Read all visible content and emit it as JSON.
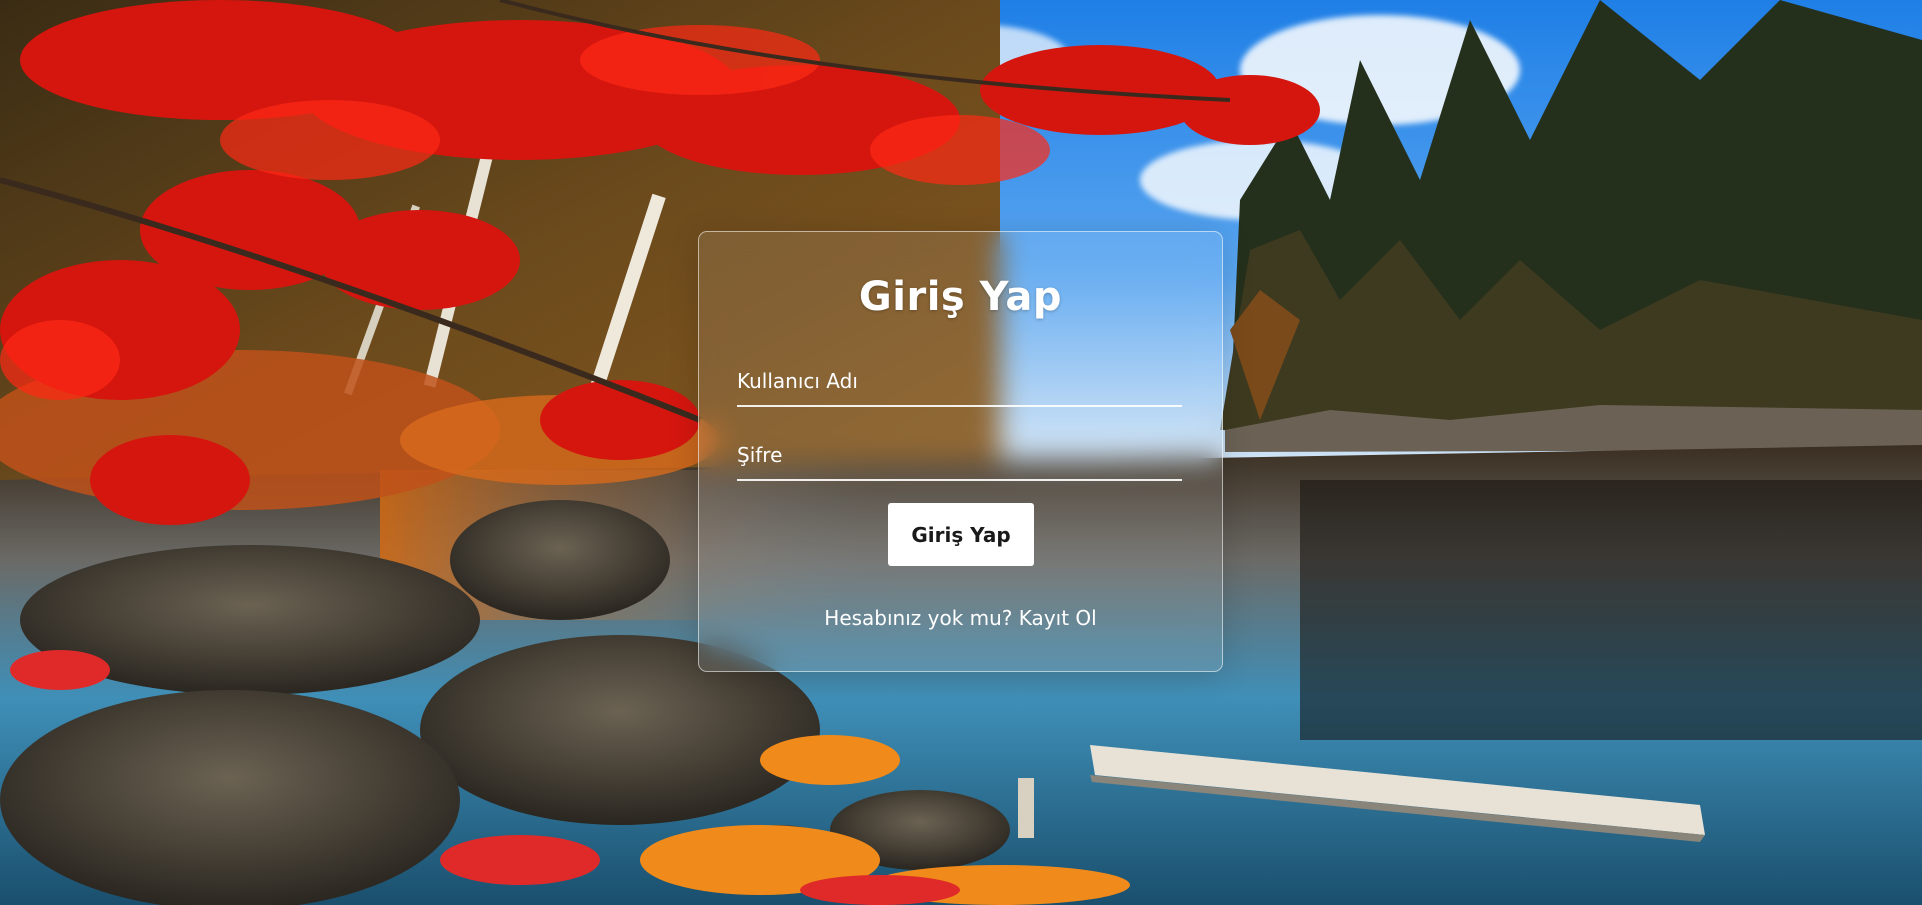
{
  "login": {
    "title": "Giriş Yap",
    "username_placeholder": "Kullanıcı Adı",
    "password_placeholder": "Şifre",
    "submit_label": "Giriş Yap",
    "signup_prompt": "Hesabınız yok mu?",
    "signup_link": "Kayıt Ol"
  }
}
